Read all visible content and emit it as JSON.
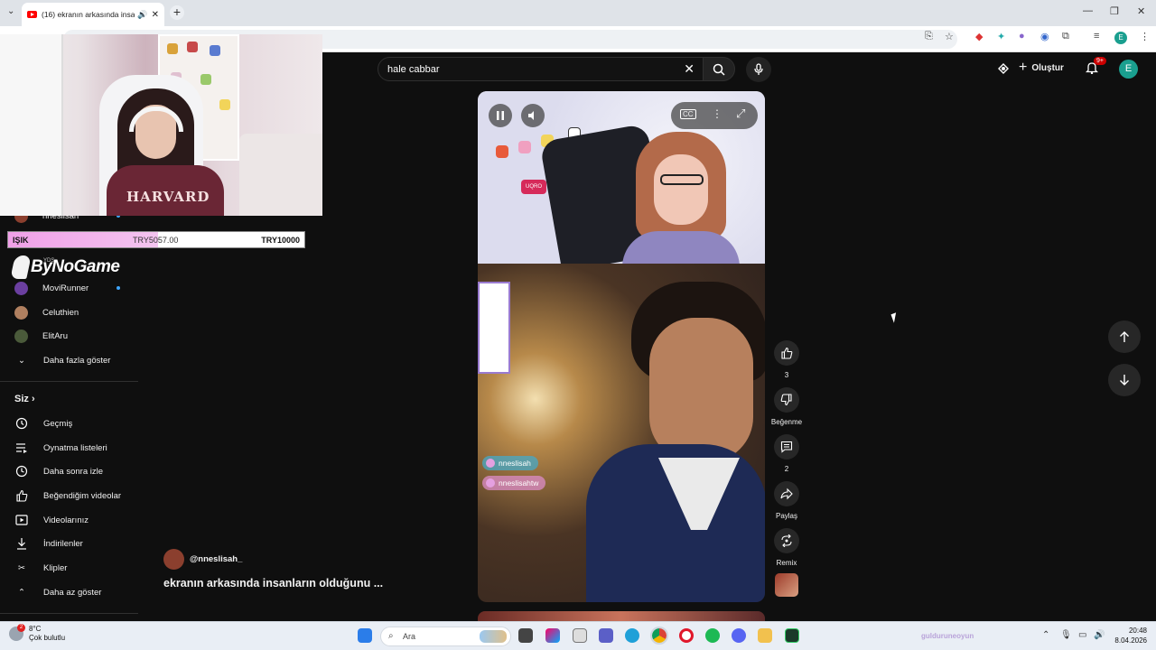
{
  "browser": {
    "tab_title": "(16) ekranın arkasında insa",
    "tab_audio_icon": "speaker-icon",
    "controls": [
      "minimize-icon",
      "restore-icon",
      "close-icon"
    ]
  },
  "youtube": {
    "search": {
      "value": "hale cabbar"
    },
    "create_label": "Oluştur",
    "notif_badge": "9+",
    "avatar_initial": "E"
  },
  "overlay": {
    "hoodie_text": "HARVARD",
    "donation": {
      "label": "IŞIK",
      "current": "TRY5057.00",
      "goal": "TRY10000",
      "progress": 0.506
    },
    "sponsor_logo": "ByNoGame",
    "sponsor_small": "YDS"
  },
  "sidebar": {
    "subscriptions": [
      {
        "label": "nneslisah",
        "color": "#8b3f2e",
        "live": true
      },
      {
        "label": "MoviRunner",
        "color": "#6b3fa0",
        "live": true
      },
      {
        "label": "Celuthien",
        "color": "#b08060",
        "live": false
      },
      {
        "label": "ElitAru",
        "color": "#4a5a3a",
        "live": false
      }
    ],
    "show_more": "Daha fazla göster",
    "you_heading": "Siz",
    "you_items": [
      {
        "label": "Geçmiş",
        "icon": "history-icon"
      },
      {
        "label": "Oynatma listeleri",
        "icon": "playlist-icon"
      },
      {
        "label": "Daha sonra izle",
        "icon": "watch-later-icon"
      },
      {
        "label": "Beğendiğim videolar",
        "icon": "like-icon"
      },
      {
        "label": "Videolarınız",
        "icon": "your-videos-icon"
      },
      {
        "label": "İndirilenler",
        "icon": "download-icon"
      },
      {
        "label": "Klipler",
        "icon": "scissors-icon"
      },
      {
        "label": "Daha az göster",
        "icon": "chevron-up-icon"
      }
    ]
  },
  "short": {
    "channel": "@nneslisah_",
    "title": "ekranın arkasında insanların olduğunu ...",
    "tags": [
      "nneslisah",
      "nneslisahtw"
    ],
    "actions": {
      "like_count": "3",
      "dislike_label": "Beğenme",
      "comment_count": "2",
      "share_label": "Paylaş",
      "remix_label": "Remix"
    },
    "wall_sign": "UQRO"
  },
  "taskbar": {
    "temp": "8°C",
    "weather": "Çok bulutlu",
    "weather_badge": "2",
    "search_placeholder": "Ara",
    "time": "20:48",
    "date": "8.04.2026",
    "faded_text": "gulduruneoyun"
  }
}
